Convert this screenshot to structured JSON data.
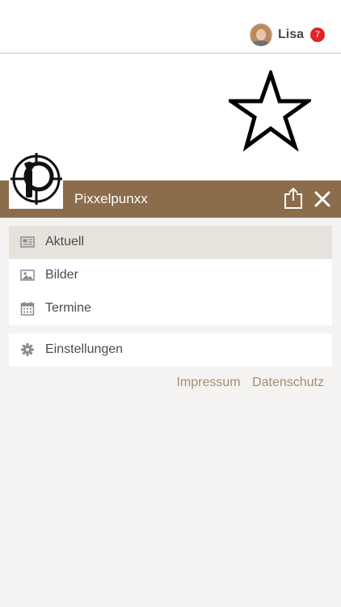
{
  "header": {
    "user_name": "Lisa",
    "notification_count": "7"
  },
  "brand": {
    "name": "Pixxelpunxx",
    "color": "#8b6c4b"
  },
  "menu": {
    "items": [
      {
        "label": "Aktuell",
        "icon": "newspaper-icon",
        "active": true
      },
      {
        "label": "Bilder",
        "icon": "image-icon",
        "active": false
      },
      {
        "label": "Termine",
        "icon": "calendar-icon",
        "active": false
      }
    ]
  },
  "settings": {
    "label": "Einstellungen",
    "icon": "gear-icon"
  },
  "footer": {
    "impressum": "Impressum",
    "datenschutz": "Datenschutz"
  }
}
